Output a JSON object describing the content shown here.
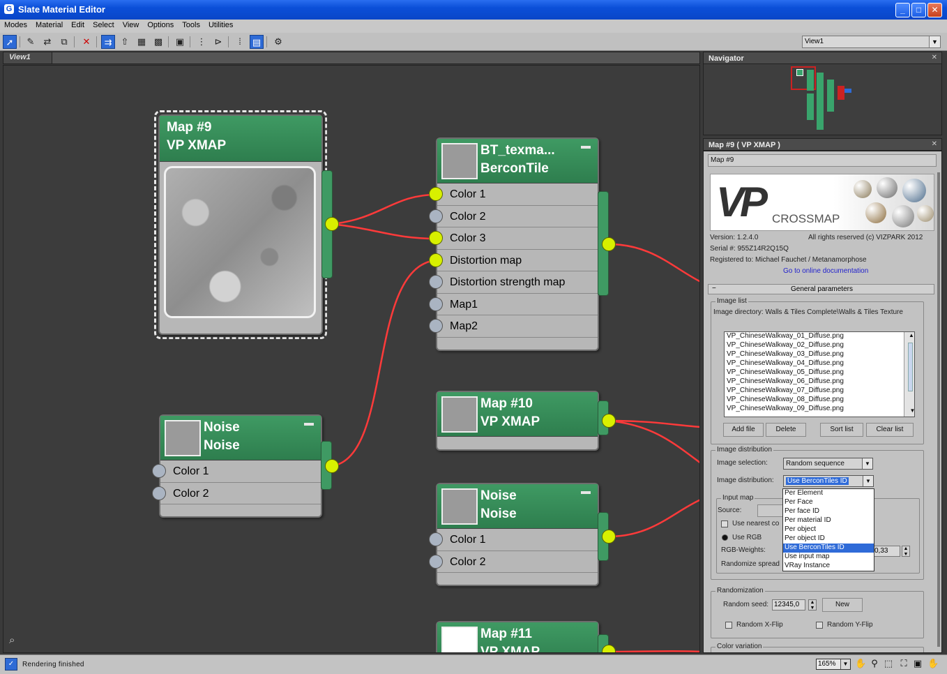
{
  "window": {
    "title": "Slate Material Editor"
  },
  "menu": [
    "Modes",
    "Material",
    "Edit",
    "Select",
    "View",
    "Options",
    "Tools",
    "Utilities"
  ],
  "view_selector": "View1",
  "canvas_tab": "View1",
  "nodes": {
    "map9": {
      "line1": "Map #9",
      "line2": "VP XMAP"
    },
    "bercon": {
      "line1": "BT_texma...",
      "line2": "BerconTile",
      "slots": [
        "Color 1",
        "Color 2",
        "Color 3",
        "Distortion map",
        "Distortion strength map",
        "Map1",
        "Map2"
      ]
    },
    "noise_left": {
      "line1": "Noise",
      "line2": "Noise",
      "slots": [
        "Color 1",
        "Color 2"
      ]
    },
    "map10": {
      "line1": "Map #10",
      "line2": "VP XMAP"
    },
    "noise_right": {
      "line1": "Noise",
      "line2": "Noise",
      "slots": [
        "Color 1",
        "Color 2"
      ]
    },
    "map11": {
      "line1": "Map #11",
      "line2": "VP XMAP"
    }
  },
  "navigator": {
    "title": "Navigator"
  },
  "params": {
    "title": "Map #9  ( VP XMAP )",
    "name_field": "Map #9",
    "logo_text": "CROSSMAP",
    "version": "Version: 1.2.4.0",
    "rights": "All rights reserved (c) VIZPARK 2012",
    "serial": "Serial #: 955Z14R2Q15Q",
    "registered": "Registered to: Michael Fauchet / Metanamorphose",
    "doc_link": "Go to online documentation",
    "rollout": "General parameters",
    "image_list_label": "Image list",
    "image_dir": "Image directory: Walls & Tiles Complete\\Walls & Tiles Texture",
    "images": [
      "VP_ChineseWalkway_01_Diffuse.png",
      "VP_ChineseWalkway_02_Diffuse.png",
      "VP_ChineseWalkway_03_Diffuse.png",
      "VP_ChineseWalkway_04_Diffuse.png",
      "VP_ChineseWalkway_05_Diffuse.png",
      "VP_ChineseWalkway_06_Diffuse.png",
      "VP_ChineseWalkway_07_Diffuse.png",
      "VP_ChineseWalkway_08_Diffuse.png",
      "VP_ChineseWalkway_09_Diffuse.png"
    ],
    "buttons": {
      "add": "Add file",
      "delete": "Delete",
      "sort": "Sort list",
      "clear": "Clear list"
    },
    "distribution_label": "Image distribution",
    "selection_label": "Image selection:",
    "selection_value": "Random sequence",
    "distribution_field_label": "Image distribution:",
    "distribution_value": "Use BerconTiles ID",
    "distribution_options": [
      "Per Element",
      "Per Face",
      "Per face ID",
      "Per material ID",
      "Per object",
      "Per object ID",
      "Use BerconTiles ID",
      "Use input map",
      "VRay Instance"
    ],
    "input_map_label": "Input map",
    "source_label": "Source:",
    "use_nearest": "Use nearest co",
    "use_rgb": "Use RGB",
    "rgb_weights": "RGB-Weights:",
    "rgb_value": "0,33",
    "randomize_spread": "Randomize spread",
    "randomization_label": "Randomization",
    "seed_label": "Random seed:",
    "seed_value": "12345,0",
    "new_button": "New",
    "xflip": "Random X-Flip",
    "yflip": "Random Y-Flip",
    "color_variation": "Color variation"
  },
  "status": {
    "text": "Rendering finished",
    "zoom": "165%"
  }
}
